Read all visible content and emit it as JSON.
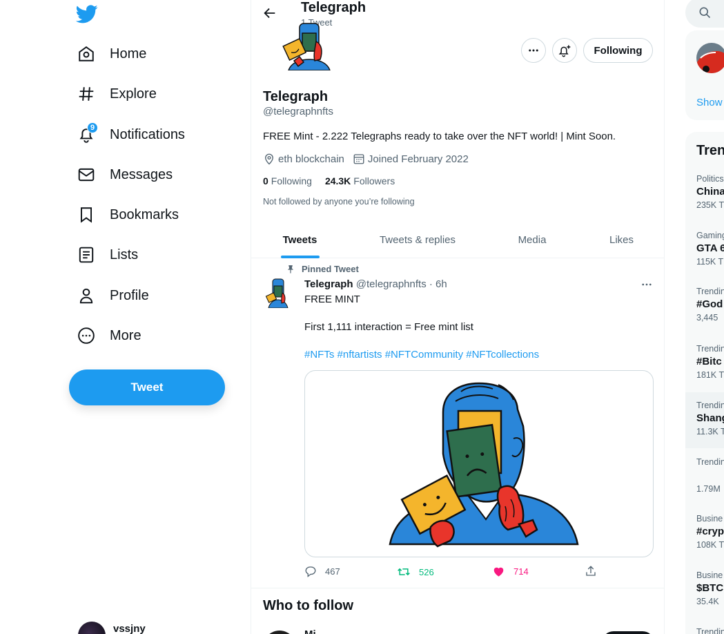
{
  "colors": {
    "accent": "#1d9bf0",
    "like": "#f91880",
    "retweet": "#00ba7c",
    "text": "#0f1419",
    "muted": "#536471"
  },
  "nav": {
    "items": [
      {
        "label": "Home",
        "icon": "home-icon"
      },
      {
        "label": "Explore",
        "icon": "hashtag-icon"
      },
      {
        "label": "Notifications",
        "icon": "bell-icon",
        "badge": "9"
      },
      {
        "label": "Messages",
        "icon": "envelope-icon"
      },
      {
        "label": "Bookmarks",
        "icon": "bookmark-icon"
      },
      {
        "label": "Lists",
        "icon": "list-icon"
      },
      {
        "label": "Profile",
        "icon": "person-icon"
      },
      {
        "label": "More",
        "icon": "more-circle-icon"
      }
    ],
    "tweet_button": "Tweet",
    "account_name": "vssjny"
  },
  "header": {
    "title": "Telegraph",
    "subtitle": "1 Tweet"
  },
  "profile": {
    "name": "Telegraph",
    "handle": "@telegraphnfts",
    "bio": "FREE Mint - 2.222 Telegraphs ready to take over the NFT world! | Mint Soon.",
    "location": "eth blockchain",
    "joined": "Joined February 2022",
    "following_count": "0",
    "following_label": "Following",
    "followers_count": "24.3K",
    "followers_label": "Followers",
    "note": "Not followed by anyone you’re following",
    "follow_button": "Following"
  },
  "tabs": [
    {
      "label": "Tweets",
      "active": true
    },
    {
      "label": "Tweets & replies",
      "active": false
    },
    {
      "label": "Media",
      "active": false
    },
    {
      "label": "Likes",
      "active": false
    }
  ],
  "tweet": {
    "pinned_label": "Pinned Tweet",
    "name": "Telegraph",
    "handle_time": "@telegraphnfts · 6h",
    "line1": "FREE MINT",
    "line2": "First 1,111 interaction = Free mint list",
    "hashtags": [
      "#NFTs",
      "#nftartists",
      "#NFTCommunity",
      "#NFTcollections"
    ],
    "replies": "467",
    "retweets": "526",
    "likes": "714"
  },
  "who_to_follow": {
    "title": "Who to follow",
    "first_name": "Mi"
  },
  "sidebar": {
    "show_more": "Show",
    "trends_title": "Tren",
    "trends": [
      {
        "category": "Politics",
        "title": "China",
        "count": "235K T"
      },
      {
        "category": "Gaming",
        "title": "GTA 6",
        "count": "115K T"
      },
      {
        "category": "Trendin",
        "title": "#God",
        "count": "3,445"
      },
      {
        "category": "Trendin",
        "title": "#Bitc",
        "count": "181K T"
      },
      {
        "category": "Trendin",
        "title": "Shang",
        "count": "11.3K T"
      },
      {
        "category": "Trendin",
        "title": "",
        "count": "1.79M"
      },
      {
        "category": "Busine",
        "title": "#cryp",
        "count": "108K T"
      },
      {
        "category": "Busine",
        "title": "$BTC",
        "count": "35.4K"
      },
      {
        "category": "Trendin",
        "title": "",
        "count": ""
      }
    ]
  }
}
